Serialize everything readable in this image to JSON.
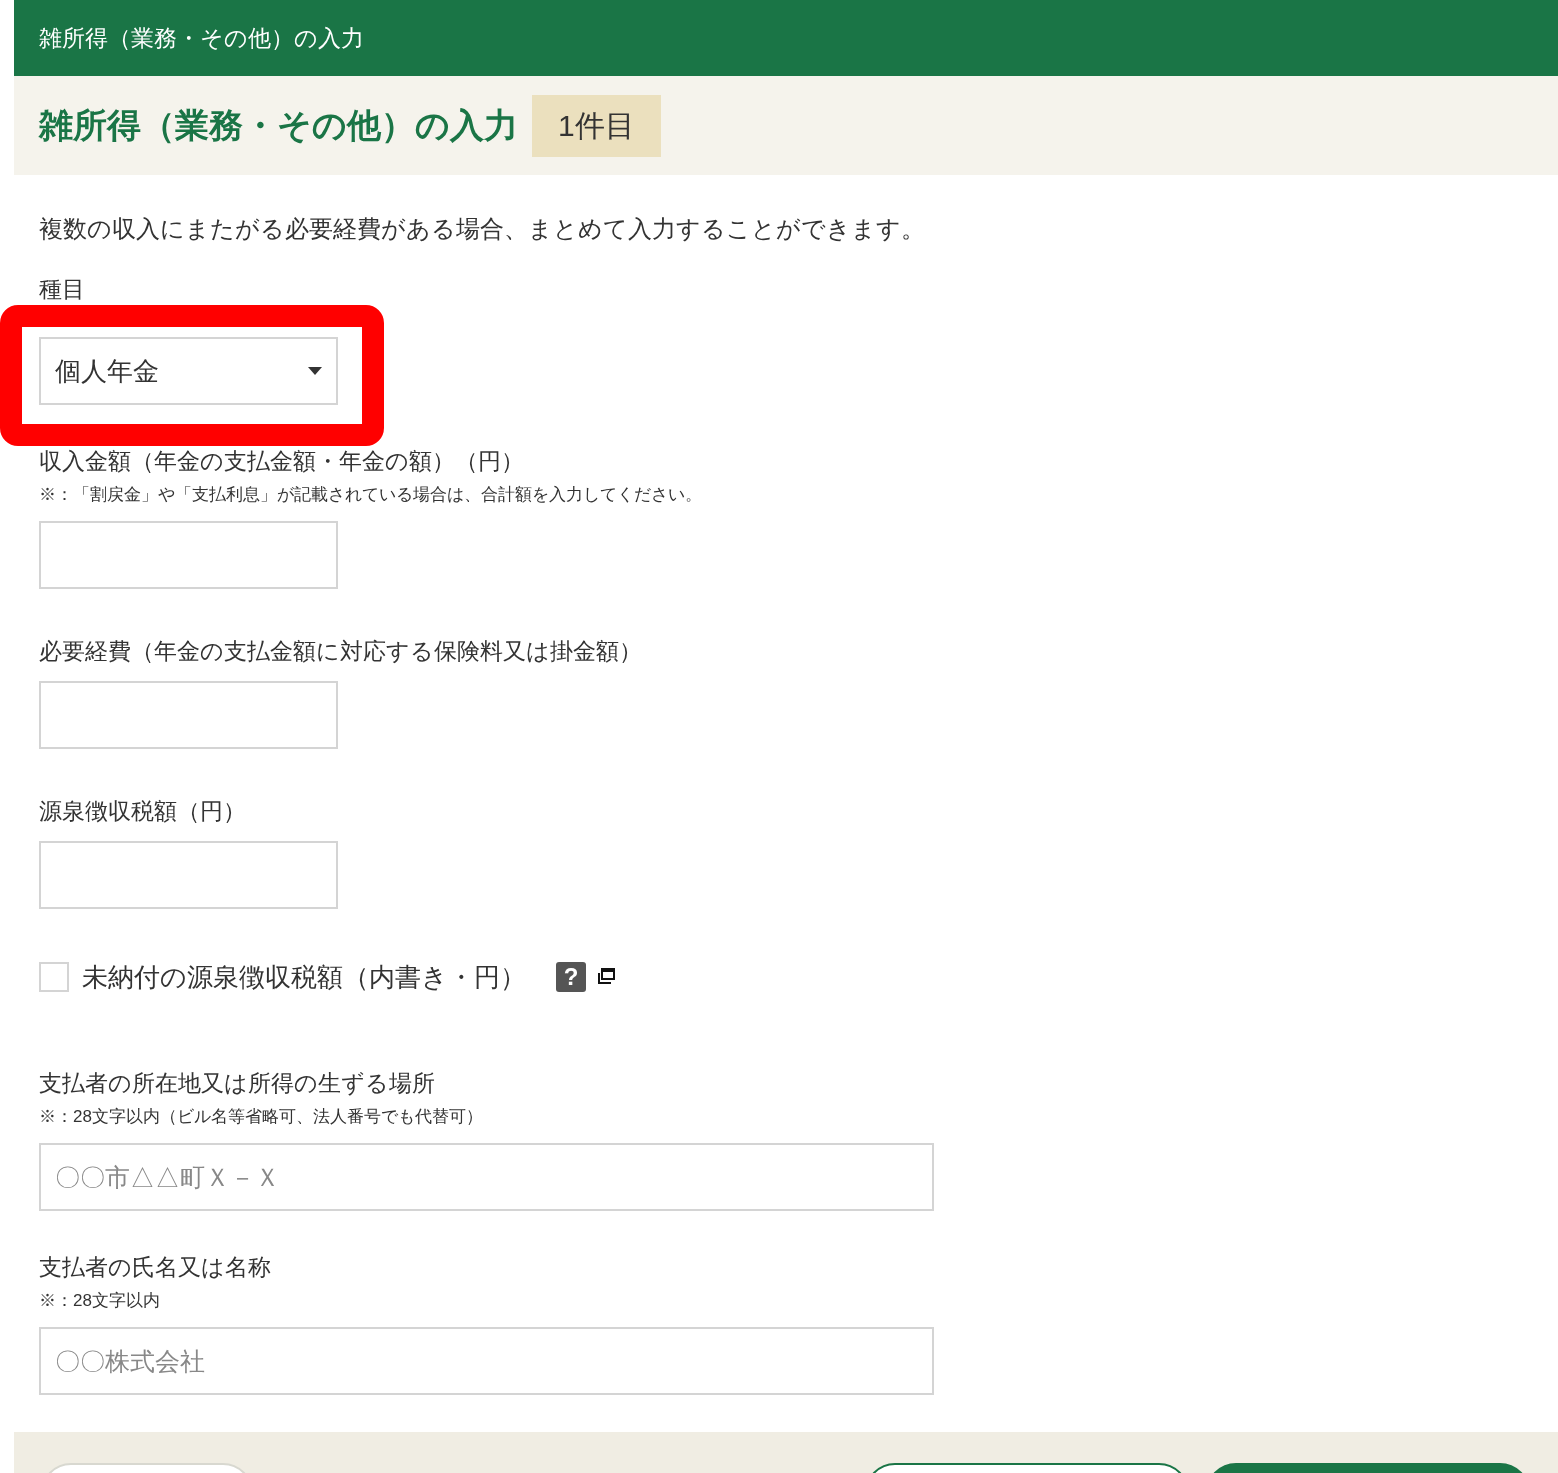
{
  "header": {
    "title": "雑所得（業務・その他）の入力"
  },
  "heading": {
    "title": "雑所得（業務・その他）の入力",
    "badge": "1件目"
  },
  "description": "複数の収入にまたがる必要経費がある場合、まとめて入力することができます。",
  "category": {
    "label": "種目",
    "value": "個人年金",
    "highlighted": true
  },
  "fields": [
    {
      "label": "収入金額（年金の支払金額・年金の額）（円）",
      "note": "※：「割戻金」や「支払利息」が記載されている場合は、合計額を入力してください。",
      "kind": "short"
    },
    {
      "label": "必要経費（年金の支払金額に対応する保険料又は掛金額）",
      "kind": "short"
    },
    {
      "label": "源泉徴収税額（円）",
      "kind": "short"
    }
  ],
  "unpaid": {
    "label": "未納付の源泉徴収税額（内書き・円）",
    "checked": false,
    "help": "?"
  },
  "payer_fields": [
    {
      "label": "支払者の所在地又は所得の生ずる場所",
      "note": "※：28文字以内（ビル名等省略可、法人番号でも代替可）",
      "placeholder": "〇〇市△△町Ｘ－Ｘ",
      "kind": "long"
    },
    {
      "label": "支払者の氏名又は名称",
      "note": "※：28文字以内",
      "placeholder": "〇〇株式会社",
      "kind": "long"
    }
  ]
}
